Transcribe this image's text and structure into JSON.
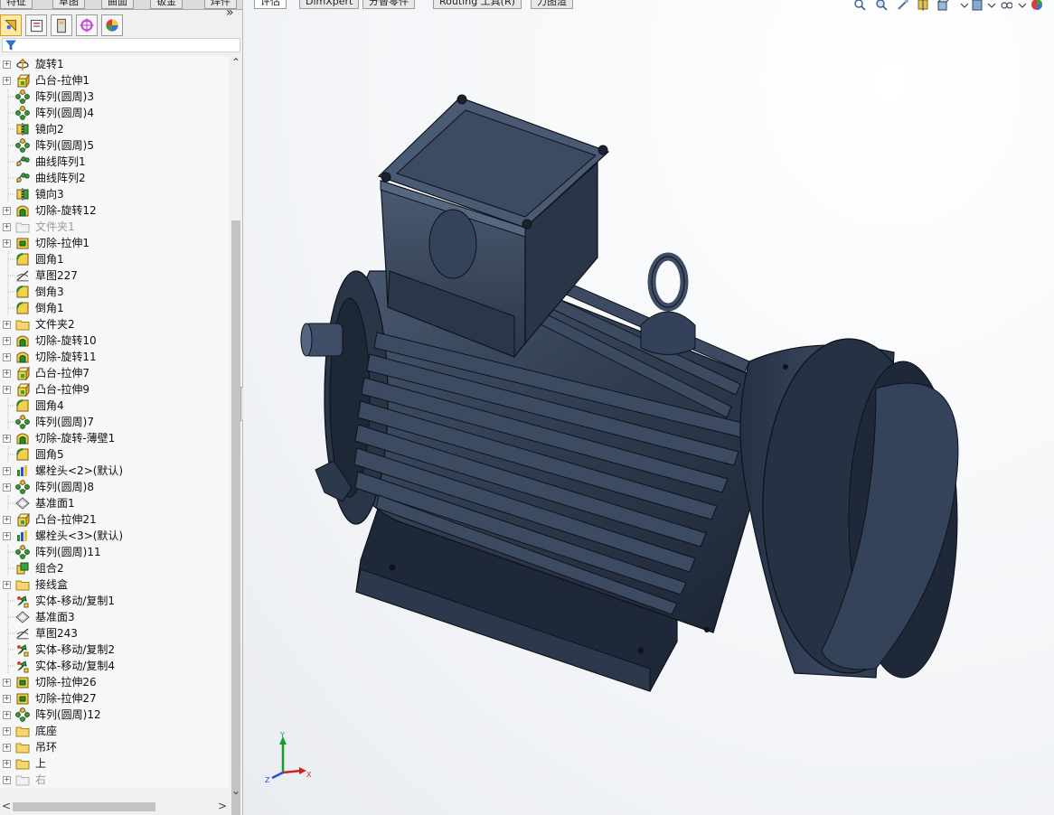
{
  "top_tabs": [
    "特征",
    "草图",
    "曲面",
    "钣金",
    "焊件"
  ],
  "doc_tabs": [
    "评估",
    "DimXpert",
    "分替零件",
    "Routing 工具(R)",
    "力图渲"
  ],
  "active_doc_tab": 0,
  "manager_tabs": [
    {
      "icon": "feature-manager-icon",
      "active": true
    },
    {
      "icon": "property-manager-icon",
      "active": false
    },
    {
      "icon": "configuration-manager-icon",
      "active": false
    },
    {
      "icon": "dimxpert-manager-icon",
      "active": false
    },
    {
      "icon": "display-manager-icon",
      "active": false
    }
  ],
  "expand_glyph": "»",
  "tree": [
    {
      "label": "旋转1",
      "icon": "revolve-icon",
      "expand": true,
      "dim": false
    },
    {
      "label": "凸台-拉伸1",
      "icon": "extrude-icon",
      "expand": true,
      "dim": false
    },
    {
      "label": "阵列(圆周)3",
      "icon": "circular-pattern-icon",
      "expand": false,
      "dim": false
    },
    {
      "label": "阵列(圆周)4",
      "icon": "circular-pattern-icon",
      "expand": false,
      "dim": false
    },
    {
      "label": "镜向2",
      "icon": "mirror-icon",
      "expand": false,
      "dim": false
    },
    {
      "label": "阵列(圆周)5",
      "icon": "circular-pattern-icon",
      "expand": false,
      "dim": false
    },
    {
      "label": "曲线阵列1",
      "icon": "curve-pattern-icon",
      "expand": false,
      "dim": false
    },
    {
      "label": "曲线阵列2",
      "icon": "curve-pattern-icon",
      "expand": false,
      "dim": false
    },
    {
      "label": "镜向3",
      "icon": "mirror-icon",
      "expand": false,
      "dim": false
    },
    {
      "label": "切除-旋转12",
      "icon": "cut-revolve-icon",
      "expand": true,
      "dim": false
    },
    {
      "label": "文件夹1",
      "icon": "folder-icon",
      "expand": true,
      "dim": true
    },
    {
      "label": "切除-拉伸1",
      "icon": "cut-extrude-icon",
      "expand": true,
      "dim": false
    },
    {
      "label": "圆角1",
      "icon": "fillet-icon",
      "expand": false,
      "dim": false
    },
    {
      "label": "草图227",
      "icon": "sketch-icon",
      "expand": false,
      "dim": false
    },
    {
      "label": "倒角3",
      "icon": "fillet-icon",
      "expand": false,
      "dim": false
    },
    {
      "label": "倒角1",
      "icon": "fillet-icon",
      "expand": false,
      "dim": false
    },
    {
      "label": "文件夹2",
      "icon": "folder-icon",
      "expand": true,
      "dim": false
    },
    {
      "label": "切除-旋转10",
      "icon": "cut-revolve-icon",
      "expand": true,
      "dim": false
    },
    {
      "label": "切除-旋转11",
      "icon": "cut-revolve-icon",
      "expand": true,
      "dim": false
    },
    {
      "label": "凸台-拉伸7",
      "icon": "extrude-icon",
      "expand": true,
      "dim": false
    },
    {
      "label": "凸台-拉伸9",
      "icon": "extrude-icon",
      "expand": true,
      "dim": false
    },
    {
      "label": "圆角4",
      "icon": "fillet-icon",
      "expand": false,
      "dim": false
    },
    {
      "label": "阵列(圆周)7",
      "icon": "circular-pattern-icon",
      "expand": false,
      "dim": false
    },
    {
      "label": "切除-旋转-薄壁1",
      "icon": "cut-revolve-icon",
      "expand": true,
      "dim": false
    },
    {
      "label": "圆角5",
      "icon": "fillet-icon",
      "expand": false,
      "dim": false
    },
    {
      "label": "螺栓头<2>(默认)",
      "icon": "library-feature-icon",
      "expand": true,
      "dim": false
    },
    {
      "label": "阵列(圆周)8",
      "icon": "circular-pattern-icon",
      "expand": true,
      "dim": false
    },
    {
      "label": "基准面1",
      "icon": "plane-icon",
      "expand": false,
      "dim": false
    },
    {
      "label": "凸台-拉伸21",
      "icon": "extrude-icon",
      "expand": true,
      "dim": false
    },
    {
      "label": "螺栓头<3>(默认)",
      "icon": "library-feature-icon",
      "expand": true,
      "dim": false
    },
    {
      "label": "阵列(圆周)11",
      "icon": "circular-pattern-icon",
      "expand": false,
      "dim": false
    },
    {
      "label": "组合2",
      "icon": "combine-icon",
      "expand": false,
      "dim": false
    },
    {
      "label": "接线盒",
      "icon": "folder-icon",
      "expand": true,
      "dim": false
    },
    {
      "label": "实体-移动/复制1",
      "icon": "move-copy-icon",
      "expand": false,
      "dim": false
    },
    {
      "label": "基准面3",
      "icon": "plane-icon",
      "expand": false,
      "dim": false
    },
    {
      "label": "草图243",
      "icon": "sketch-icon",
      "expand": false,
      "dim": false
    },
    {
      "label": "实体-移动/复制2",
      "icon": "move-copy-icon",
      "expand": false,
      "dim": false
    },
    {
      "label": "实体-移动/复制4",
      "icon": "move-copy-icon",
      "expand": false,
      "dim": false
    },
    {
      "label": "切除-拉伸26",
      "icon": "cut-extrude-icon",
      "expand": true,
      "dim": false
    },
    {
      "label": "切除-拉伸27",
      "icon": "cut-extrude-icon",
      "expand": true,
      "dim": false
    },
    {
      "label": "阵列(圆周)12",
      "icon": "circular-pattern-icon",
      "expand": true,
      "dim": false
    },
    {
      "label": "底座",
      "icon": "folder-icon",
      "expand": true,
      "dim": false
    },
    {
      "label": "吊环",
      "icon": "folder-icon",
      "expand": true,
      "dim": false
    },
    {
      "label": "上",
      "icon": "folder-icon",
      "expand": true,
      "dim": false
    },
    {
      "label": "右",
      "icon": "folder-icon",
      "expand": true,
      "dim": true
    }
  ],
  "triad": {
    "x": "X",
    "y": "Y",
    "z": "Z"
  },
  "colors": {
    "model_body": "#2f3b4e",
    "model_dark": "#1f2838",
    "model_light": "#4a5a72"
  }
}
